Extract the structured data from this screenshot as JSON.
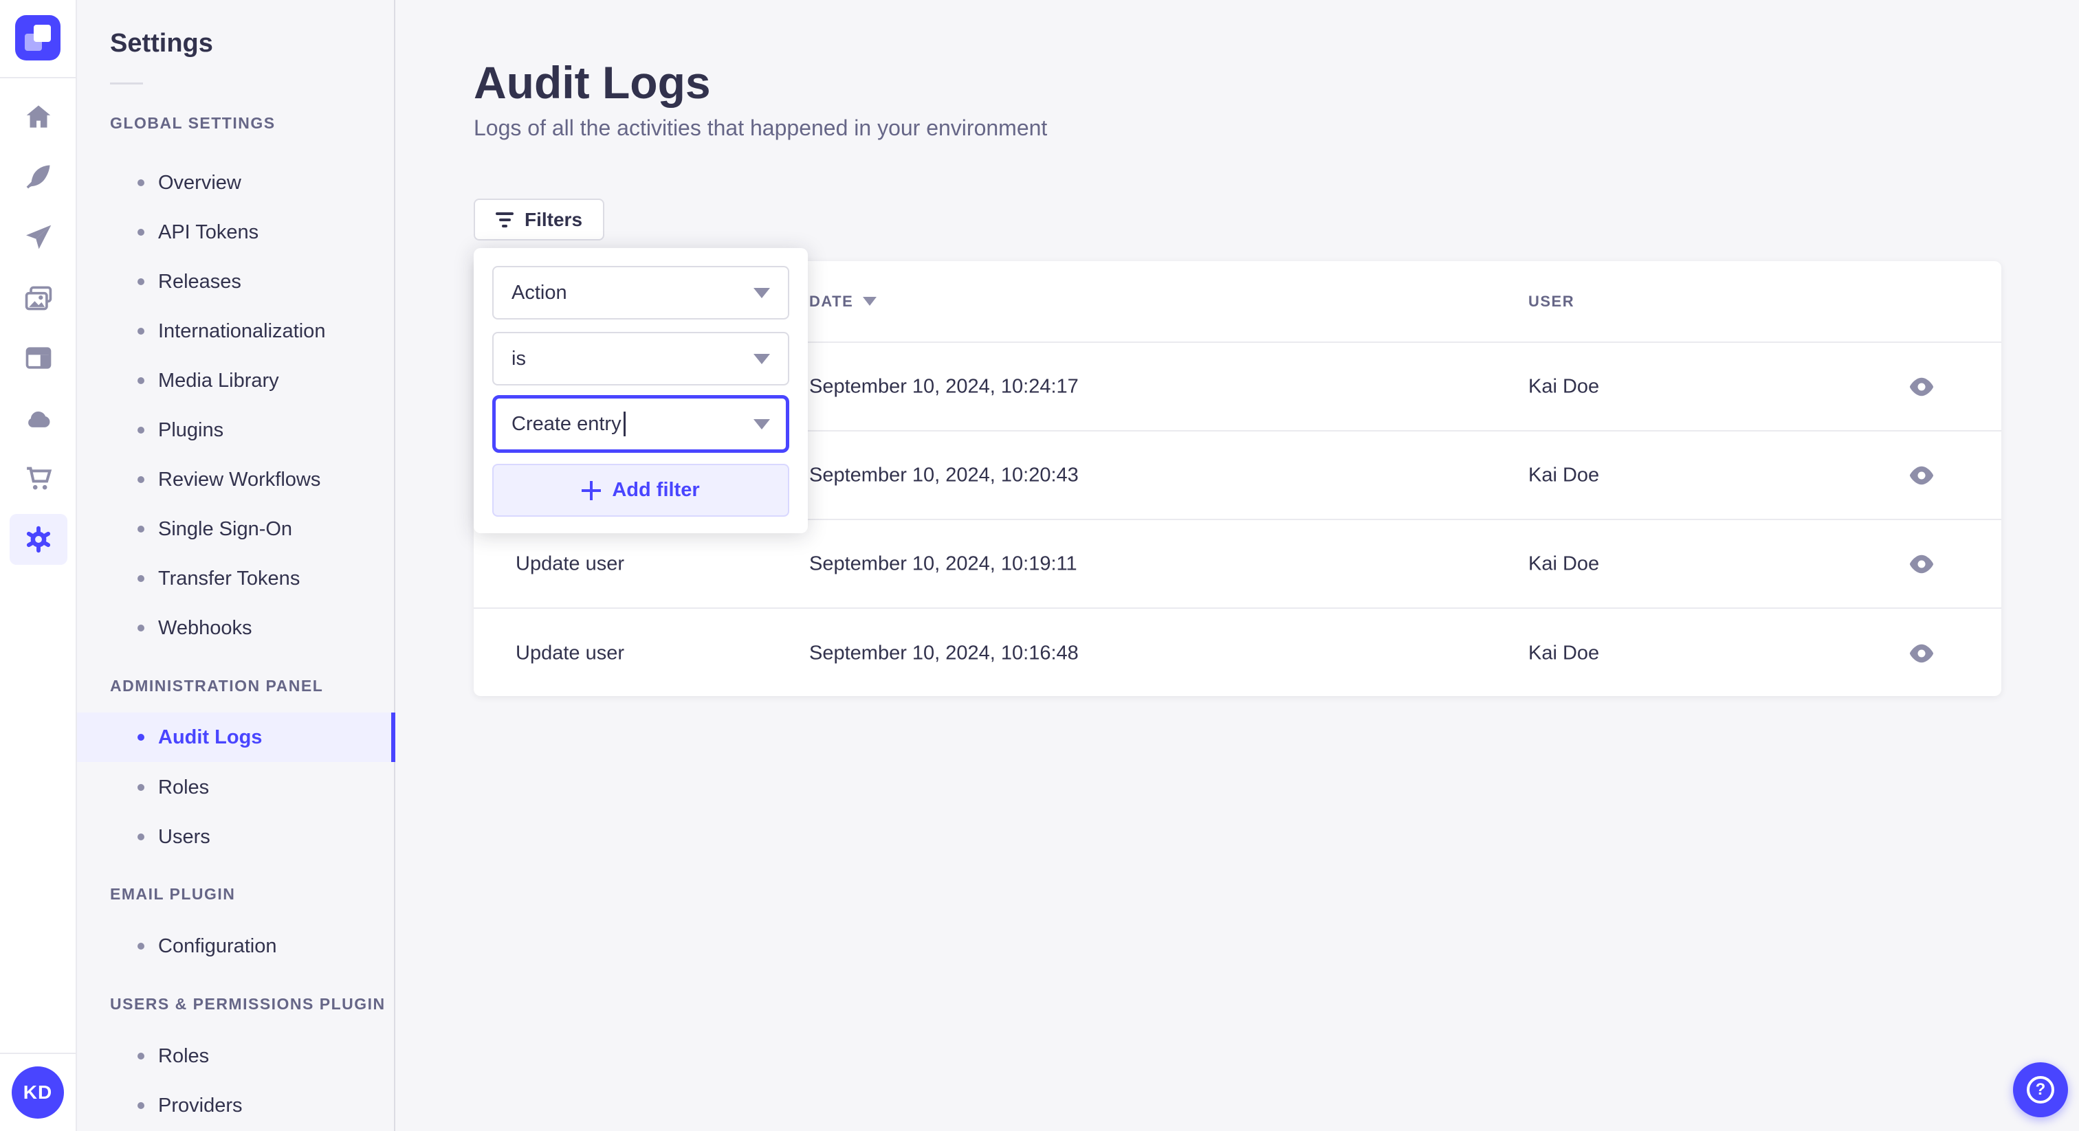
{
  "icon_rail": {
    "logo": "strapi-logo",
    "icons": [
      "home",
      "feather",
      "paper-plane",
      "media-library",
      "layout",
      "cloud",
      "cart",
      "settings-gear"
    ],
    "active_icon": "settings-gear",
    "avatar_initials": "KD"
  },
  "sidebar": {
    "title": "Settings",
    "sections": [
      {
        "heading": "GLOBAL SETTINGS",
        "items": [
          "Overview",
          "API Tokens",
          "Releases",
          "Internationalization",
          "Media Library",
          "Plugins",
          "Review Workflows",
          "Single Sign-On",
          "Transfer Tokens",
          "Webhooks"
        ]
      },
      {
        "heading": "ADMINISTRATION PANEL",
        "items": [
          "Audit Logs",
          "Roles",
          "Users"
        ],
        "active_item": "Audit Logs"
      },
      {
        "heading": "EMAIL PLUGIN",
        "items": [
          "Configuration"
        ]
      },
      {
        "heading": "USERS & PERMISSIONS PLUGIN",
        "items": [
          "Roles",
          "Providers"
        ]
      }
    ]
  },
  "main": {
    "title": "Audit Logs",
    "subtitle": "Logs of all the activities that happened in your environment",
    "filters_button": "Filters"
  },
  "filter_popover": {
    "field_select": "Action",
    "operator_select": "is",
    "value_combobox": "Create entry",
    "add_filter_button": "Add filter"
  },
  "table": {
    "headers": {
      "action": "",
      "date": "DATE",
      "user": "USER"
    },
    "rows": [
      {
        "action": "",
        "date": "September 10, 2024, 10:24:17",
        "user": "Kai Doe"
      },
      {
        "action": "",
        "date": "September 10, 2024, 10:20:43",
        "user": "Kai Doe"
      },
      {
        "action": "Update user",
        "date": "September 10, 2024, 10:19:11",
        "user": "Kai Doe"
      },
      {
        "action": "Update user",
        "date": "September 10, 2024, 10:16:48",
        "user": "Kai Doe"
      }
    ]
  },
  "help_button": "?",
  "colors": {
    "primary": "#4945ff",
    "primary_light": "#f0f0ff",
    "text_dark": "#32324d",
    "text_muted": "#666687",
    "icon_gray": "#8e8ea9",
    "border": "#dcdce4",
    "background": "#f6f6f9"
  }
}
